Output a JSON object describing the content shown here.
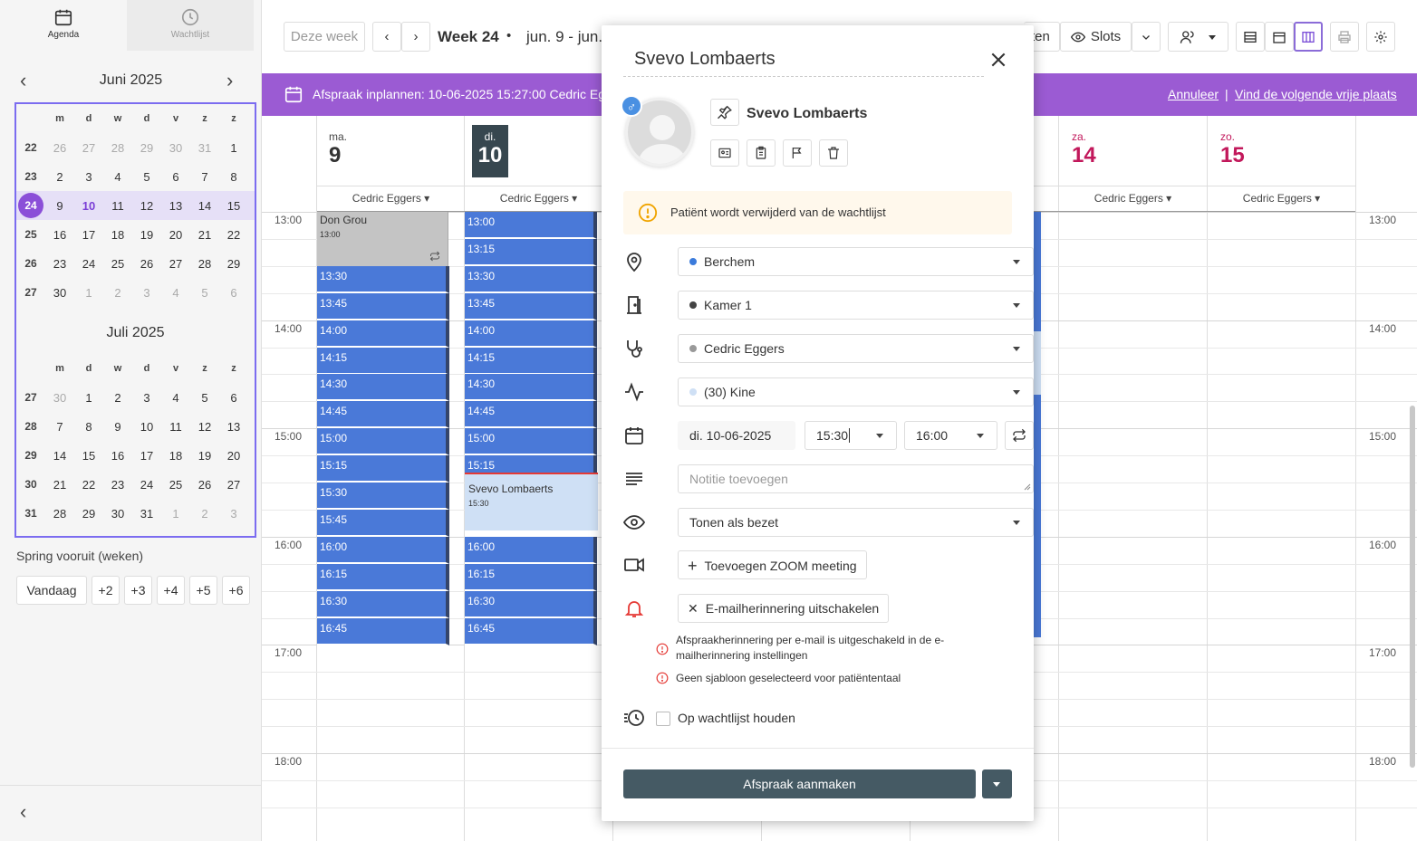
{
  "sidebar": {
    "tabs": [
      {
        "label": "Agenda"
      },
      {
        "label": "Wachtlijst"
      }
    ],
    "months": [
      {
        "title": "Juni 2025"
      },
      {
        "title": "Juli 2025"
      }
    ],
    "weekday_headers": [
      "m",
      "d",
      "w",
      "d",
      "v",
      "z",
      "z"
    ],
    "june_weeks": [
      [
        "22",
        "26",
        "27",
        "28",
        "29",
        "30",
        "31",
        "1"
      ],
      [
        "23",
        "2",
        "3",
        "4",
        "5",
        "6",
        "7",
        "8"
      ],
      [
        "24",
        "9",
        "10",
        "11",
        "12",
        "13",
        "14",
        "15"
      ],
      [
        "25",
        "16",
        "17",
        "18",
        "19",
        "20",
        "21",
        "22"
      ],
      [
        "26",
        "23",
        "24",
        "25",
        "26",
        "27",
        "28",
        "29"
      ],
      [
        "27",
        "30",
        "1",
        "2",
        "3",
        "4",
        "5",
        "6"
      ]
    ],
    "july_weeks": [
      [
        "27",
        "30",
        "1",
        "2",
        "3",
        "4",
        "5",
        "6"
      ],
      [
        "28",
        "7",
        "8",
        "9",
        "10",
        "11",
        "12",
        "13"
      ],
      [
        "29",
        "14",
        "15",
        "16",
        "17",
        "18",
        "19",
        "20"
      ],
      [
        "30",
        "21",
        "22",
        "23",
        "24",
        "25",
        "26",
        "27"
      ],
      [
        "31",
        "28",
        "29",
        "30",
        "31",
        "1",
        "2",
        "3"
      ]
    ],
    "jump_label": "Spring vooruit (weken)",
    "jump_buttons": [
      "Vandaag",
      "+2",
      "+3",
      "+4",
      "+5",
      "+6"
    ]
  },
  "toolbar": {
    "this_week": "Deze week",
    "week_label": "Week 24",
    "range": "jun. 9 - jun.",
    "bullet": "•",
    "partial_label": "ten",
    "slots_label": "Slots"
  },
  "banner": {
    "text": "Afspraak inplannen: 10-06-2025 15:27:00 Cedric Egg",
    "cancel": "Annuleer",
    "separator": "|",
    "next_free": "Vind de volgende vrije plaats"
  },
  "calendar": {
    "days": [
      {
        "name": "ma.",
        "num": "9",
        "therapist": "Cedric Eggers"
      },
      {
        "name": "di.",
        "num": "10",
        "therapist": "Cedric Eggers"
      },
      {
        "name": "za.",
        "num": "14",
        "therapist": "Cedric Eggers"
      },
      {
        "name": "zo.",
        "num": "15",
        "therapist": "Cedric Eggers"
      }
    ],
    "hours": [
      "13:00",
      "14:00",
      "15:00",
      "16:00",
      "17:00",
      "18:00"
    ],
    "mon_appointment": {
      "title": "Don Grou",
      "time": "13:00"
    },
    "mon_slots": [
      "13:30",
      "13:45",
      "14:00",
      "14:15",
      "14:30",
      "14:45",
      "15:00",
      "15:15",
      "15:30",
      "15:45",
      "16:00",
      "16:15",
      "16:30",
      "16:45"
    ],
    "tue_slots_before": [
      "13:00",
      "13:15",
      "13:30",
      "13:45",
      "14:00",
      "14:15",
      "14:30",
      "14:45",
      "15:00",
      "15:15"
    ],
    "tue_appointment": {
      "title": "Svevo Lombaerts",
      "time": "15:30"
    },
    "tue_slots_after": [
      "16:00",
      "16:15",
      "16:30",
      "16:45"
    ]
  },
  "modal": {
    "title": "Svevo Lombaerts",
    "patient_name": "Svevo Lombaerts",
    "gender_symbol": "♂",
    "warning": "Patiënt wordt verwijderd van de wachtlijst",
    "location": "Berchem",
    "room": "Kamer 1",
    "therapist": "Cedric Eggers",
    "service": "(30) Kine",
    "date": "di. 10-06-2025",
    "start_time": "15:30",
    "end_time": "16:00",
    "note_placeholder": "Notitie toevoegen",
    "visibility": "Tonen als bezet",
    "zoom_button": "Toevoegen ZOOM meeting",
    "email_button": "E-mailherinnering uitschakelen",
    "email_warnings": [
      "Afspraakherinnering per e-mail is uitgeschakeld in de e-",
      "mailherinnering instellingen",
      "Geen sjabloon geselecteerd voor patiëntentaal"
    ],
    "waitlist_label": "Op wachtlijst houden",
    "submit": "Afspraak aanmaken"
  },
  "colors": {
    "accent_purple": "#9b5bd3",
    "slot_blue": "#4a79d8",
    "weekend_red": "#c2185b",
    "submit_dark": "#455a64"
  }
}
